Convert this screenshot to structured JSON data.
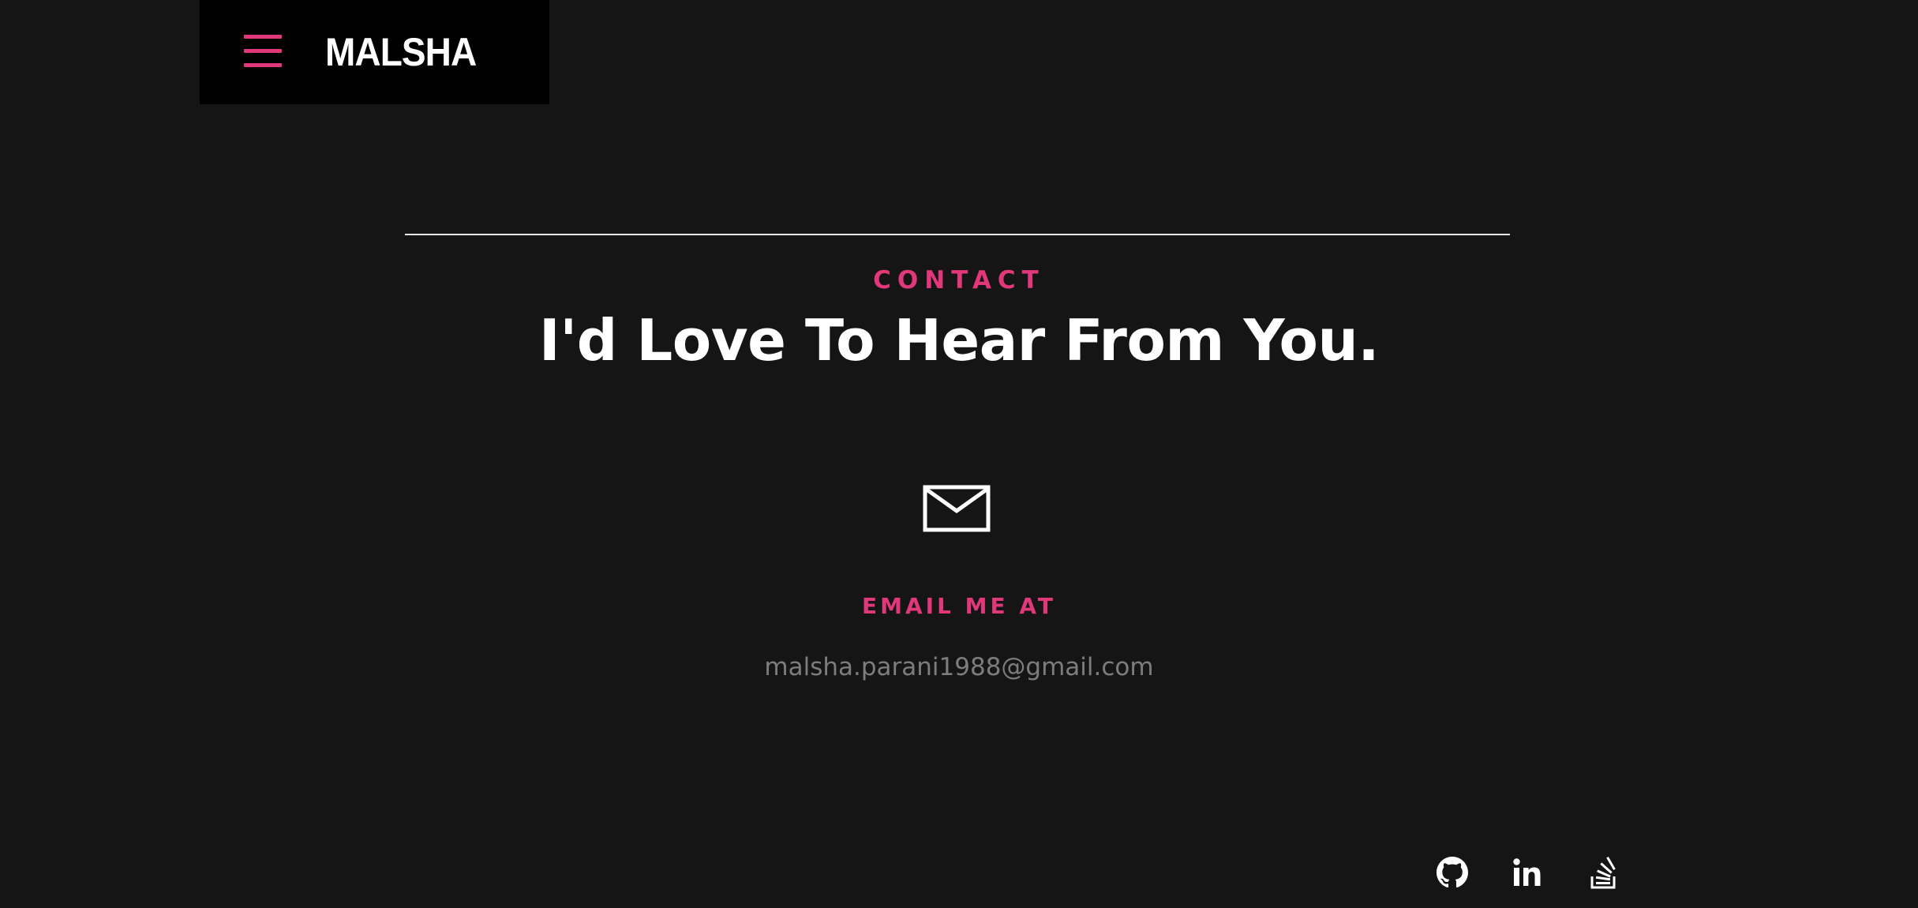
{
  "header": {
    "logo_text": "MALSHA",
    "menu_icon": "hamburger-menu-icon",
    "accent_color": "#e0387a",
    "background_color": "#000000"
  },
  "contact": {
    "section_label": "CONTACT",
    "headline": "I'd Love To Hear From You.",
    "icon": "envelope-icon",
    "email_label": "EMAIL ME AT",
    "email": "malsha.parani1988@gmail.com"
  },
  "social": {
    "items": [
      {
        "icon": "github-icon"
      },
      {
        "icon": "linkedin-icon"
      },
      {
        "icon": "stackoverflow-icon"
      }
    ]
  },
  "colors": {
    "page_background": "#151515",
    "accent": "#e0387a",
    "heading": "#ffffff",
    "muted_text": "#7d7d7d"
  }
}
